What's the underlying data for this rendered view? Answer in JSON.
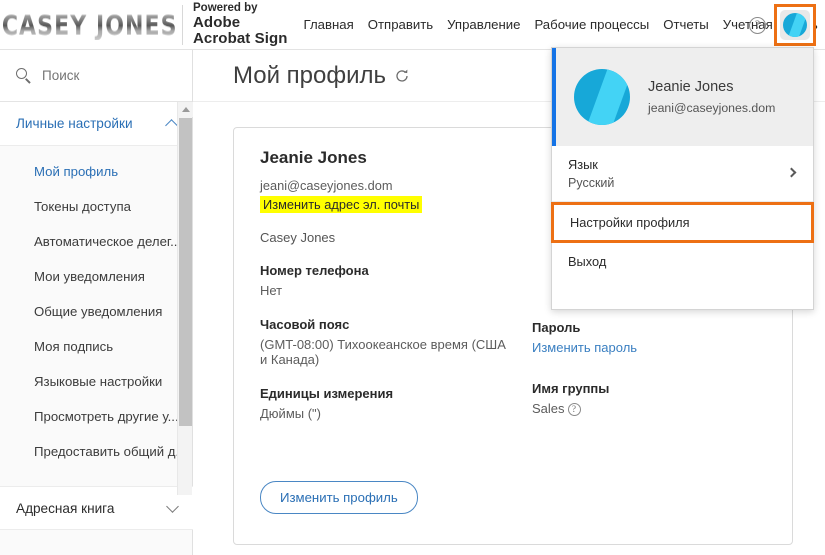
{
  "brand": {
    "logo_text": "CASEY JONES",
    "powered_by": "Powered by",
    "product_line1": "Adobe",
    "product_line2": "Acrobat Sign"
  },
  "topnav": {
    "items": [
      {
        "label": "Главная"
      },
      {
        "label": "Отправить"
      },
      {
        "label": "Управление"
      },
      {
        "label": "Рабочие процессы"
      },
      {
        "label": "Отчеты"
      },
      {
        "label": "Учетная запись"
      }
    ],
    "help_glyph": "?",
    "avatar_highlight_color": "#ED7014"
  },
  "sidebar": {
    "search_placeholder": "Поиск",
    "search_value": "",
    "group_personal": "Личные настройки",
    "group_address_book": "Адресная книга",
    "items": [
      {
        "label": "Мой профиль",
        "active": true
      },
      {
        "label": "Токены доступа",
        "active": false
      },
      {
        "label": "Автоматическое делег...",
        "active": false
      },
      {
        "label": "Мои уведомления",
        "active": false
      },
      {
        "label": "Общие уведомления",
        "active": false
      },
      {
        "label": "Моя подпись",
        "active": false
      },
      {
        "label": "Языковые настройки",
        "active": false
      },
      {
        "label": "Просмотреть другие у...",
        "active": false
      },
      {
        "label": "Предоставить общий д...",
        "active": false
      }
    ]
  },
  "main": {
    "page_title": "Мой профиль",
    "profile": {
      "name": "Jeanie Jones",
      "email": "jeani@caseyjones.dom",
      "edit_email_link": "Изменить адрес эл. почты",
      "company": "Casey Jones"
    },
    "fields_left": [
      {
        "label": "Номер телефона",
        "value": "Нет",
        "type": "text"
      },
      {
        "label": "Часовой пояс",
        "value": "(GMT-08:00) Тихоокеанское время (США и Канада)",
        "type": "text"
      },
      {
        "label": "Единицы измерения",
        "value": "Дюймы (\")",
        "type": "text"
      }
    ],
    "fields_right": [
      {
        "label": "Пароль",
        "value": "Изменить пароль",
        "type": "link"
      },
      {
        "label": "Имя группы",
        "value": "Sales",
        "type": "text-with-help",
        "help_glyph": "?"
      }
    ],
    "edit_profile_button": "Изменить профиль",
    "highlight_color": "#ffff00"
  },
  "dropdown": {
    "user_name": "Jeanie Jones",
    "user_email": "jeani@caseyjones.dom",
    "rows": [
      {
        "title": "Язык",
        "subtitle": "Русский",
        "has_arrow": true,
        "highlighted": false
      },
      {
        "title": "Настройки профиля",
        "subtitle": "",
        "has_arrow": false,
        "highlighted": true
      },
      {
        "title": "Выход",
        "subtitle": "",
        "has_arrow": false,
        "highlighted": false
      }
    ],
    "highlight_color": "#ED7014",
    "accent_bar_color": "#1473E6"
  }
}
